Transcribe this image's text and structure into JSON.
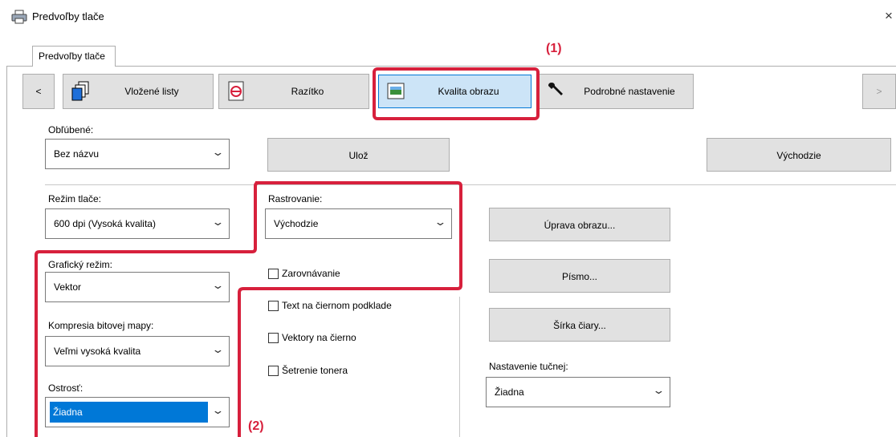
{
  "window": {
    "title": "Predvoľby tlače",
    "close_label": "×"
  },
  "tab": {
    "label": "Predvoľby tlače"
  },
  "nav": {
    "prev": "<",
    "next": ">",
    "items": [
      {
        "label": "Vložené listy",
        "icon": "stacked-sheets-icon"
      },
      {
        "label": "Razítko",
        "icon": "stamp-icon"
      },
      {
        "label": "Kvalita obrazu",
        "icon": "image-quality-icon",
        "selected": true
      },
      {
        "label": "Podrobné nastavenie",
        "icon": "wrench-icon"
      }
    ]
  },
  "favorites": {
    "label": "Obľúbené:",
    "value": "Bez názvu",
    "save": "Ulož",
    "defaults": "Východzie"
  },
  "print_mode": {
    "label": "Režim tlače:",
    "value": "600 dpi (Vysoká kvalita)"
  },
  "rasterization": {
    "label": "Rastrovanie:",
    "value": "Východzie"
  },
  "alignment": {
    "label": "Zarovnávanie",
    "checked": false
  },
  "graphic_mode": {
    "label": "Grafický režim:",
    "value": "Vektor"
  },
  "bitmap_compression": {
    "label": "Kompresia bitovej mapy:",
    "value": "Veľmi vysoká kvalita"
  },
  "sharpness": {
    "label": "Ostrosť:",
    "value": "Žiadna"
  },
  "checkboxes": {
    "text_black_bg": "Text na čiernom podklade",
    "vectors_black": "Vektory na čierno",
    "toner_save": "Šetrenie tonera"
  },
  "buttons": {
    "image_adjust": "Úprava obrazu...",
    "font": "Písmo...",
    "line_width": "Šírka čiary..."
  },
  "bold": {
    "label": "Nastavenie tučnej:",
    "value": "Žiadna"
  },
  "annotations": {
    "one": "(1)",
    "two": "(2)"
  },
  "colors": {
    "highlight_red": "#d7203c",
    "selection_blue": "#0078d7",
    "selected_tab_bg": "#cce4f7"
  }
}
